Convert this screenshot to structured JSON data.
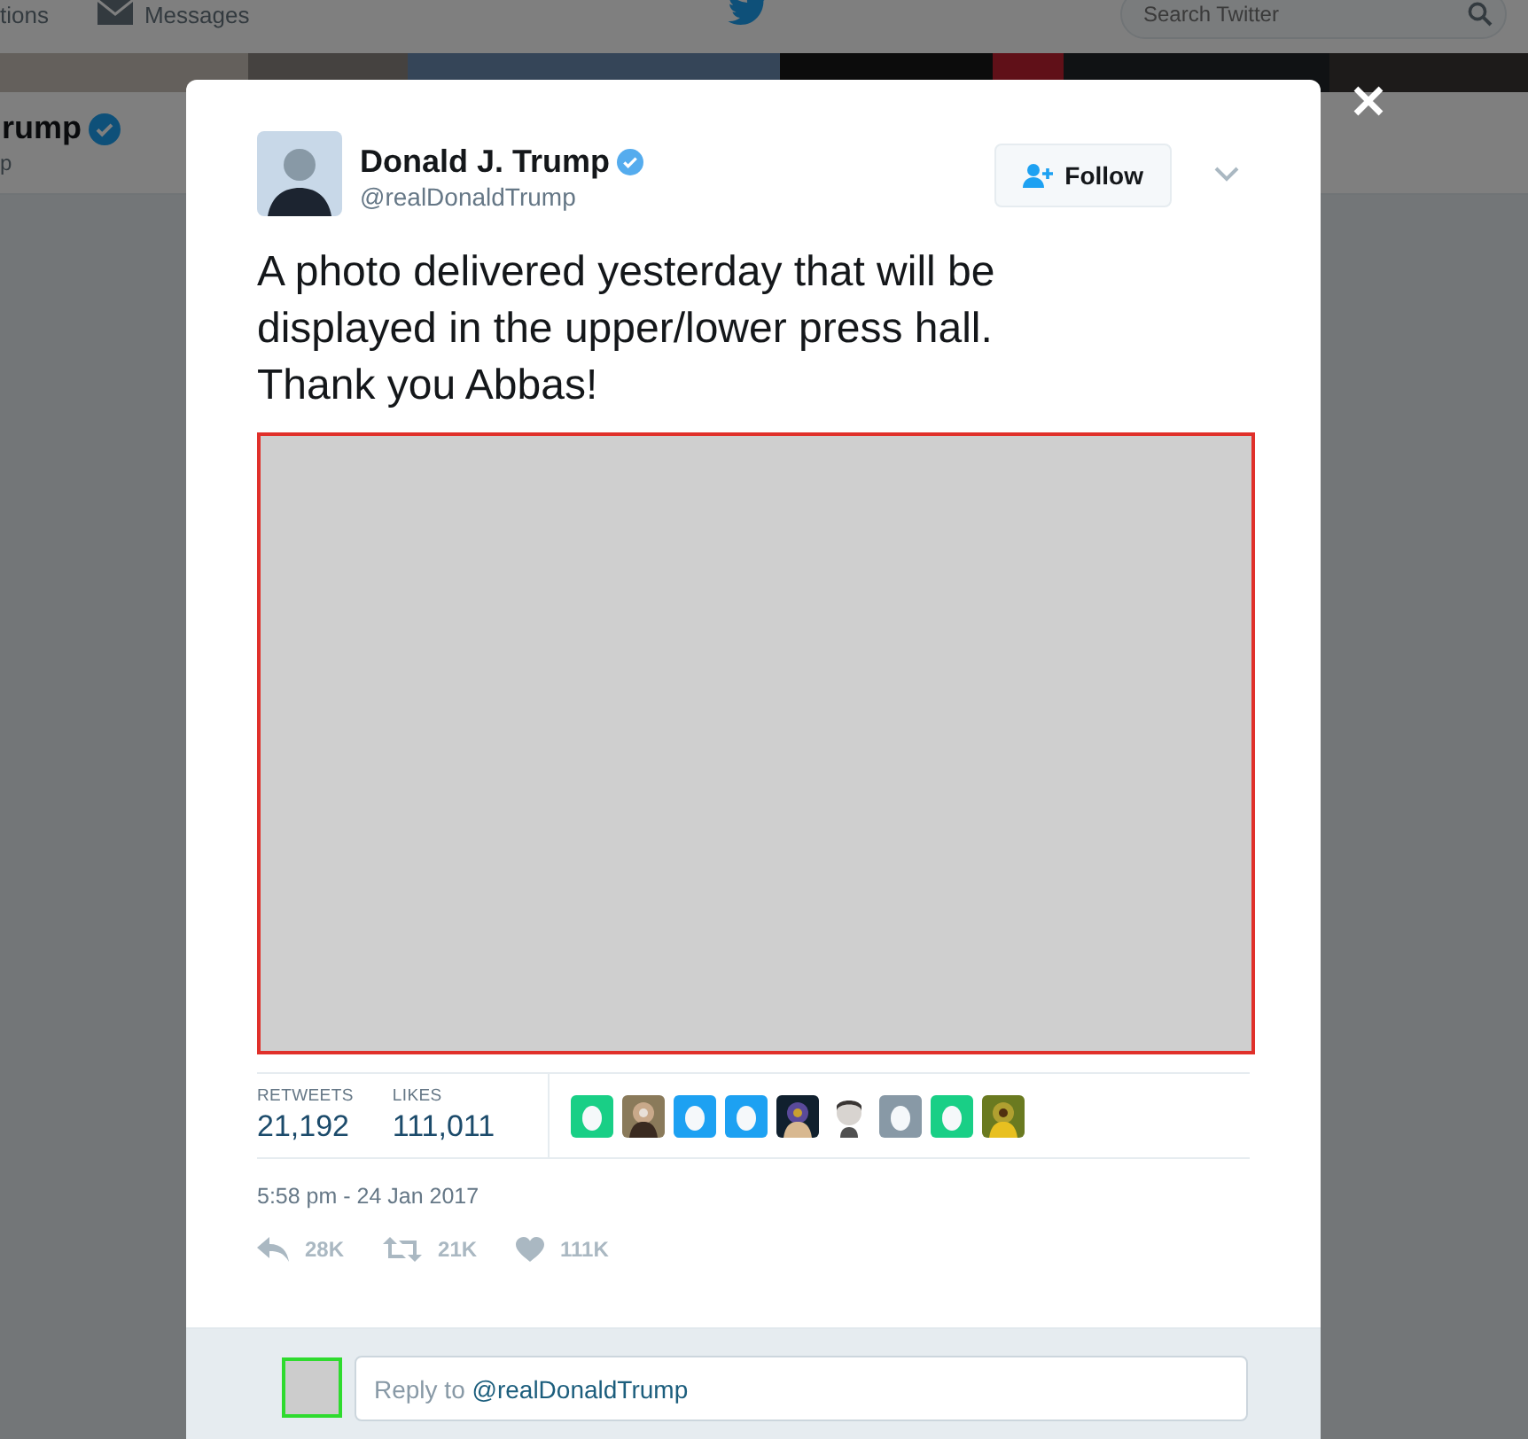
{
  "background": {
    "nav": [
      {
        "kind": "plain",
        "label": "tions"
      },
      {
        "kind": "messages",
        "label": "Messages"
      }
    ],
    "search": {
      "placeholder": "Search Twitter"
    },
    "profile": {
      "name": "rump",
      "verified": true,
      "handle": "p"
    }
  },
  "tweet": {
    "author": {
      "name": "Donald J. Trump",
      "verified": true,
      "handle": "@realDonaldTrump"
    },
    "follow_button": "Follow",
    "text": "A photo delivered yesterday that will be displayed in the upper/lower press hall. Thank you Abbas!",
    "media": {
      "kind": "placeholder"
    },
    "stats": [
      {
        "label": "RETWEETS",
        "value": "21,192"
      },
      {
        "label": "LIKES",
        "value": "111,011"
      }
    ],
    "likers": [
      {
        "kind": "egg",
        "color": "#19cf86"
      },
      {
        "kind": "picture"
      },
      {
        "kind": "egg",
        "color": "#1da1f2"
      },
      {
        "kind": "egg",
        "color": "#1da1f2"
      },
      {
        "kind": "picture"
      },
      {
        "kind": "silhouette"
      },
      {
        "kind": "egg",
        "color": "#8899a6"
      },
      {
        "kind": "egg",
        "color": "#19cf86"
      },
      {
        "kind": "picture"
      }
    ],
    "timestamp": "5:58 pm - 24 Jan 2017",
    "actions": [
      {
        "kind": "reply",
        "count": "28K"
      },
      {
        "kind": "retweet",
        "count": "21K"
      },
      {
        "kind": "like",
        "count": "111K"
      }
    ]
  },
  "reply": {
    "placeholder": "Reply to",
    "mention": "@realDonaldTrump"
  }
}
